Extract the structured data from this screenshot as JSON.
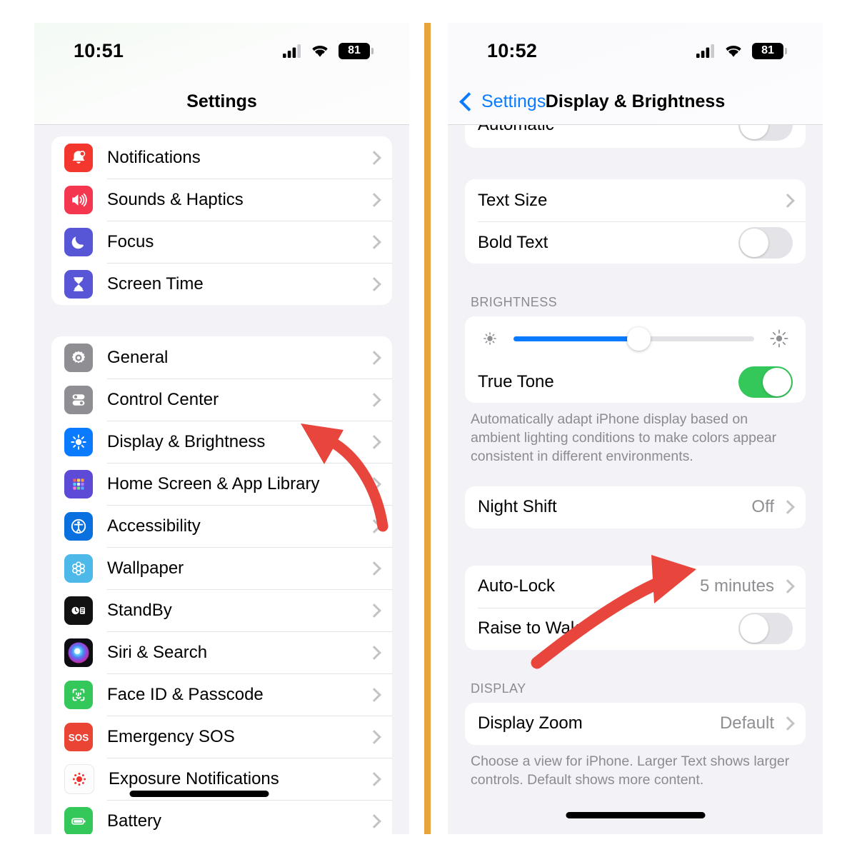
{
  "meta": {
    "divider_color": "#e8a33d",
    "accent_blue": "#0a7aff",
    "toggle_on_green": "#34c759",
    "arrow_red": "#e8453c"
  },
  "left_phone": {
    "status": {
      "time": "10:51",
      "battery": "81",
      "cellular_icon": "cellular-bars-icon",
      "wifi_icon": "wifi-icon",
      "battery_icon": "battery-icon"
    },
    "nav": {
      "title": "Settings"
    },
    "groups": [
      {
        "rows": [
          {
            "label": "Notifications",
            "icon": "notifications-icon",
            "accessory": "chevron"
          },
          {
            "label": "Sounds & Haptics",
            "icon": "sounds-haptics-icon",
            "accessory": "chevron"
          },
          {
            "label": "Focus",
            "icon": "focus-icon",
            "accessory": "chevron"
          },
          {
            "label": "Screen Time",
            "icon": "screen-time-icon",
            "accessory": "chevron"
          }
        ]
      },
      {
        "rows": [
          {
            "label": "General",
            "icon": "general-icon",
            "accessory": "chevron"
          },
          {
            "label": "Control Center",
            "icon": "control-center-icon",
            "accessory": "chevron"
          },
          {
            "label": "Display & Brightness",
            "icon": "display-brightness-icon",
            "accessory": "chevron"
          },
          {
            "label": "Home Screen & App Library",
            "icon": "home-screen-icon",
            "accessory": "chevron"
          },
          {
            "label": "Accessibility",
            "icon": "accessibility-icon",
            "accessory": "chevron"
          },
          {
            "label": "Wallpaper",
            "icon": "wallpaper-icon",
            "accessory": "chevron"
          },
          {
            "label": "StandBy",
            "icon": "standby-icon",
            "accessory": "chevron"
          },
          {
            "label": "Siri & Search",
            "icon": "siri-search-icon",
            "accessory": "chevron"
          },
          {
            "label": "Face ID & Passcode",
            "icon": "face-id-icon",
            "accessory": "chevron"
          },
          {
            "label": "Emergency SOS",
            "icon": "emergency-sos-icon",
            "accessory": "chevron"
          },
          {
            "label": "Exposure Notifications",
            "icon": "exposure-notifications-icon",
            "accessory": "chevron"
          },
          {
            "label": "Battery",
            "icon": "battery-settings-icon",
            "accessory": "chevron"
          }
        ]
      }
    ]
  },
  "right_phone": {
    "status": {
      "time": "10:52",
      "battery": "81",
      "cellular_icon": "cellular-bars-icon",
      "wifi_icon": "wifi-icon",
      "battery_icon": "battery-icon"
    },
    "nav": {
      "back_label": "Settings",
      "title": "Display & Brightness",
      "back_icon": "chevron-left-icon"
    },
    "appearance_partial": {
      "label": "Automatic",
      "toggle_state": "off"
    },
    "text_group": {
      "text_size": {
        "label": "Text Size",
        "accessory": "chevron"
      },
      "bold_text": {
        "label": "Bold Text",
        "toggle_state": "off"
      }
    },
    "brightness": {
      "section_title": "BRIGHTNESS",
      "slider": {
        "value_percent": 52,
        "low_icon": "brightness-low-icon",
        "high_icon": "brightness-high-icon"
      },
      "true_tone": {
        "label": "True Tone",
        "toggle_state": "on"
      },
      "note": "Automatically adapt iPhone display based on ambient lighting conditions to make colors appear consistent in different environments."
    },
    "night_shift": {
      "label": "Night Shift",
      "value": "Off",
      "accessory": "chevron"
    },
    "lock_group": {
      "auto_lock": {
        "label": "Auto-Lock",
        "value": "5 minutes",
        "accessory": "chevron"
      },
      "raise_to_wake": {
        "label": "Raise to Wake",
        "toggle_state": "off"
      }
    },
    "display": {
      "section_title": "DISPLAY",
      "display_zoom": {
        "label": "Display Zoom",
        "value": "Default",
        "accessory": "chevron"
      },
      "note": "Choose a view for iPhone. Larger Text shows larger controls. Default shows more content."
    }
  },
  "annotations": [
    {
      "name": "arrow-to-display-brightness",
      "color": "#e8453c",
      "points_at": "Display & Brightness"
    },
    {
      "name": "arrow-to-auto-lock-value",
      "color": "#e8453c",
      "points_at": "5 minutes"
    }
  ]
}
